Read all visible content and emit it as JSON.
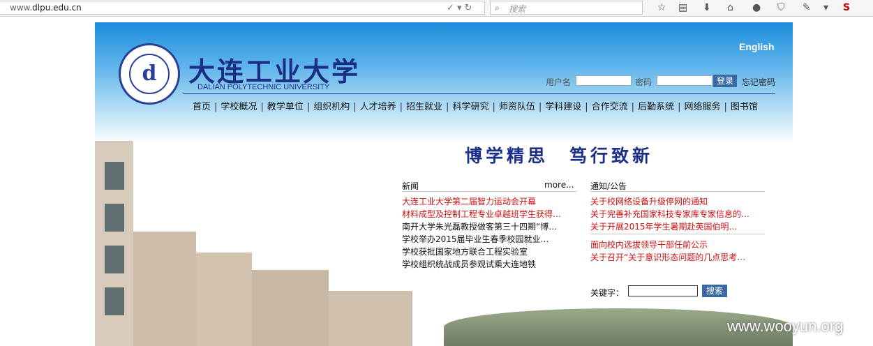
{
  "browser": {
    "url_prefix": "www.",
    "url_domain": "dlpu.edu.cn",
    "search_placeholder": "搜索"
  },
  "header": {
    "logo_title": "大连工业大学",
    "logo_en": "DALIAN POLYTECHNIC UNIVERSITY",
    "logo_mark": "d",
    "english_link": "English",
    "login": {
      "username_label": "用户名",
      "password_label": "密码",
      "login_button": "登录",
      "forgot_link": "忘记密码"
    },
    "nav": [
      "首页",
      "学校概况",
      "教学单位",
      "组织机构",
      "人才培养",
      "招生就业",
      "科学研究",
      "师资队伍",
      "学科建设",
      "合作交流",
      "后勤系统",
      "网络服务",
      "图书馆"
    ]
  },
  "slogan": "博学精思　笃行致新",
  "news": {
    "title": "新闻",
    "more": "more...",
    "items": [
      "大连工业大学第二届智力运动会开幕",
      "材料成型及控制工程专业卓越班学生获得…",
      "南开大学朱光磊教授做客第三十四期“博…",
      "学校举办2015届毕业生春季校园就业…",
      "学校获批国家地方联合工程实验室",
      "学校组织统战成员参观试乘大连地铁"
    ]
  },
  "notice": {
    "title": "通知/公告",
    "items_top": [
      "关于校网络设备升级停网的通知",
      "关于完善补充国家科技专家库专家信息的…",
      "关于开展2015年学生暑期赴英国伯明…"
    ],
    "items_bottom": [
      "面向校内选拔领导干部任前公示",
      "关于召开“关于意识形态问题的几点思考…"
    ]
  },
  "search": {
    "keyword_label": "关键字：",
    "button": "搜索"
  },
  "watermark": "www.wooyun.org",
  "colors": {
    "link_red": "#cc1111",
    "brand_blue": "#1a2e86",
    "button_blue": "#3a6aa6"
  }
}
